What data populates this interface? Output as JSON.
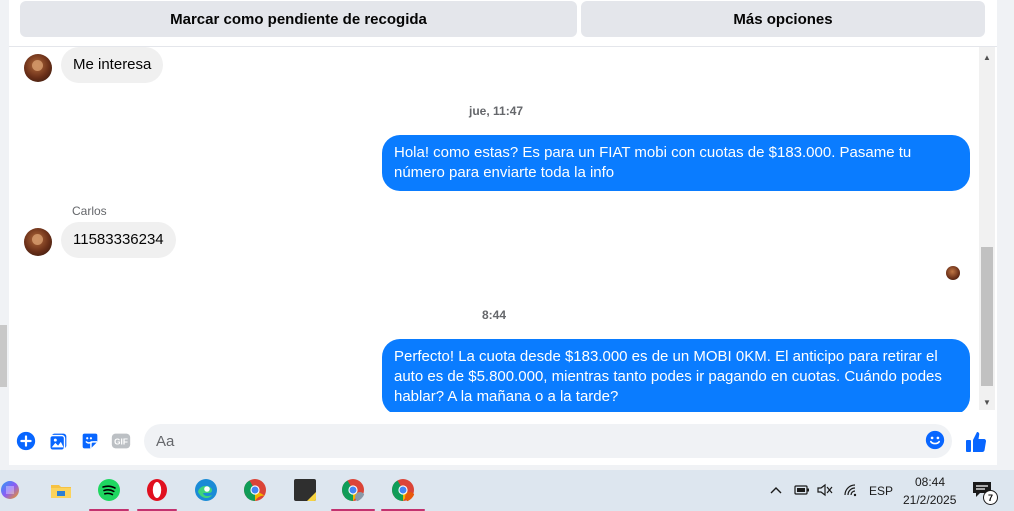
{
  "actions": {
    "mark_pending": "Marcar como pendiente de recogida",
    "more_options": "Más opciones"
  },
  "messages": {
    "m1_text": "Me interesa",
    "ts1": "jue, 11:47",
    "m2_text": "Hola! como estas? Es para un FIAT mobi con cuotas de $183.000. Pasame tu número para enviarte toda la info",
    "sender_name": "Carlos",
    "m3_text": "11583336234",
    "ts2": "8:44",
    "m4_text": "Perfecto! La cuota desde $183.000 es de un MOBI 0KM. El anticipo para retirar el auto es de $5.800.000, mientras tanto podes ir pagando en cuotas. Cuándo podes hablar? A la mañana o a la tarde?"
  },
  "composer": {
    "placeholder": "Aa"
  },
  "taskbar": {
    "language": "ESP",
    "time": "08:44",
    "date": "21/2/2025",
    "notifications_count": "7"
  },
  "colors": {
    "outgoing_bubble": "#0a7cff",
    "incoming_bubble": "#f0f0f0",
    "accent": "#0866ff"
  }
}
